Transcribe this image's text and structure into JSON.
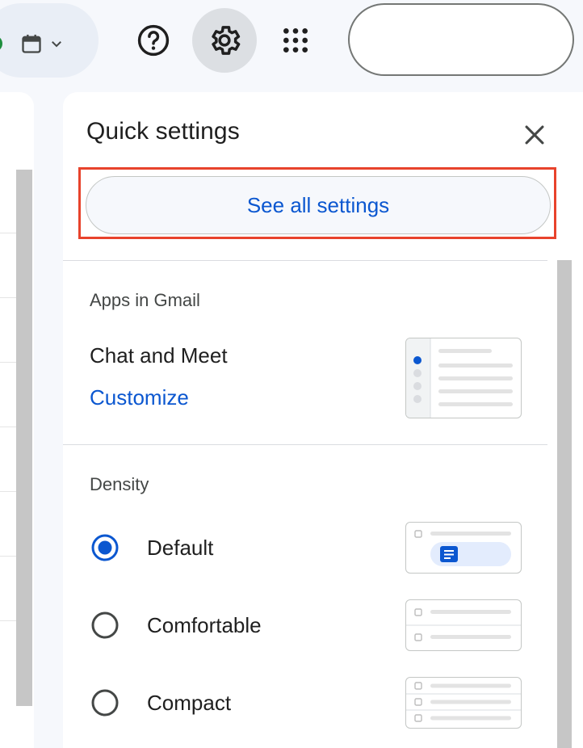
{
  "panel": {
    "title": "Quick settings",
    "see_all_label": "See all settings"
  },
  "apps": {
    "section_title": "Apps in Gmail",
    "chat_label": "Chat and Meet",
    "customize_link": "Customize"
  },
  "density": {
    "section_title": "Density",
    "options": [
      {
        "label": "Default",
        "selected": true
      },
      {
        "label": "Comfortable",
        "selected": false
      },
      {
        "label": "Compact",
        "selected": false
      }
    ]
  },
  "icons": {
    "status": "green-dot-icon",
    "calendar": "calendar-icon",
    "chevron": "chevron-down-icon",
    "help": "help-icon",
    "settings": "gear-icon",
    "apps": "apps-grid-icon",
    "close": "close-icon"
  },
  "colors": {
    "accent": "#0b57d0",
    "highlight": "#e8432c",
    "status_green": "#1e8e3e"
  }
}
